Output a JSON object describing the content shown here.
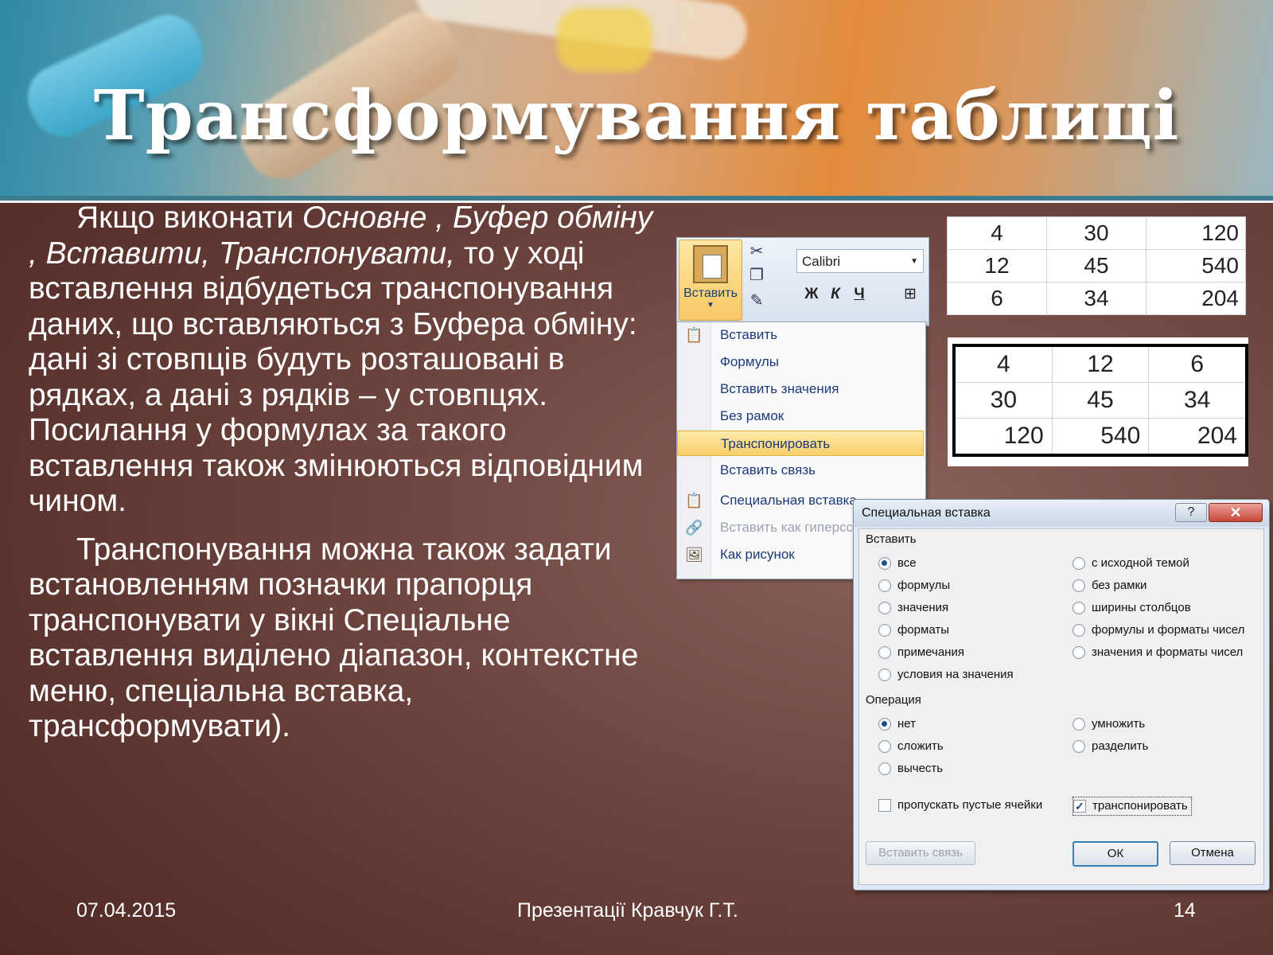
{
  "slide": {
    "title": "Трансформування таблиці",
    "paragraph1": {
      "lead": "Якщо виконати ",
      "path": "Основне , Буфер обміну , Вставити, Транспонувати,",
      "rest": " то у ході вставлення відбудеться транспонування даних, що вставляються з Буфера обміну: дані зі стовпців будуть розташовані в рядках, а дані з рядків – у стовпцях. Посилання у формулах за такого вставлення також змінюються відповідним чином."
    },
    "paragraph2": "Транспонування можна також задати встановленням позначки прапорця транспонувати у вікні Спеціальне вставлення виділено діапазон, контекстне меню, спеціальна вставка, трансформувати).",
    "footer": {
      "date": "07.04.2015",
      "author": "Презентації Кравчук Г.Т.",
      "page": "14"
    }
  },
  "ribbon": {
    "paste_label": "Вставить",
    "font_name": "Calibri",
    "bold": "Ж",
    "italic": "К",
    "underline": "Ч"
  },
  "paste_menu": {
    "items": [
      {
        "label": "Вставить"
      },
      {
        "label": "Формулы"
      },
      {
        "label": "Вставить значения"
      },
      {
        "label": "Без рамок"
      },
      {
        "label": "Транспонировать"
      },
      {
        "label": "Вставить связь"
      },
      {
        "label": "Специальная вставка..."
      },
      {
        "label": "Вставить как гиперссылку"
      },
      {
        "label": "Как рисунок"
      }
    ]
  },
  "table_original": {
    "rows": [
      [
        "4",
        "30",
        "120"
      ],
      [
        "12",
        "45",
        "540"
      ],
      [
        "6",
        "34",
        "204"
      ]
    ]
  },
  "table_transposed": {
    "rows": [
      [
        "4",
        "12",
        "6"
      ],
      [
        "30",
        "45",
        "34"
      ],
      [
        "120",
        "540",
        "204"
      ]
    ]
  },
  "dialog": {
    "title": "Специальная вставка",
    "help": "?",
    "close": "✕",
    "paste_group": "Вставить",
    "paste_options_left": [
      "все",
      "формулы",
      "значения",
      "форматы",
      "примечания",
      "условия на значения"
    ],
    "paste_options_right": [
      "с исходной темой",
      "без рамки",
      "ширины столбцов",
      "формулы и форматы чисел",
      "значения и форматы чисел"
    ],
    "operation_group": "Операция",
    "operation_left": [
      "нет",
      "сложить",
      "вычесть"
    ],
    "operation_right": [
      "умножить",
      "разделить"
    ],
    "skip_blanks": "пропускать пустые ячейки",
    "transpose": "транспонировать",
    "paste_link_btn": "Вставить связь",
    "ok_btn": "ОК",
    "cancel_btn": "Отмена"
  }
}
